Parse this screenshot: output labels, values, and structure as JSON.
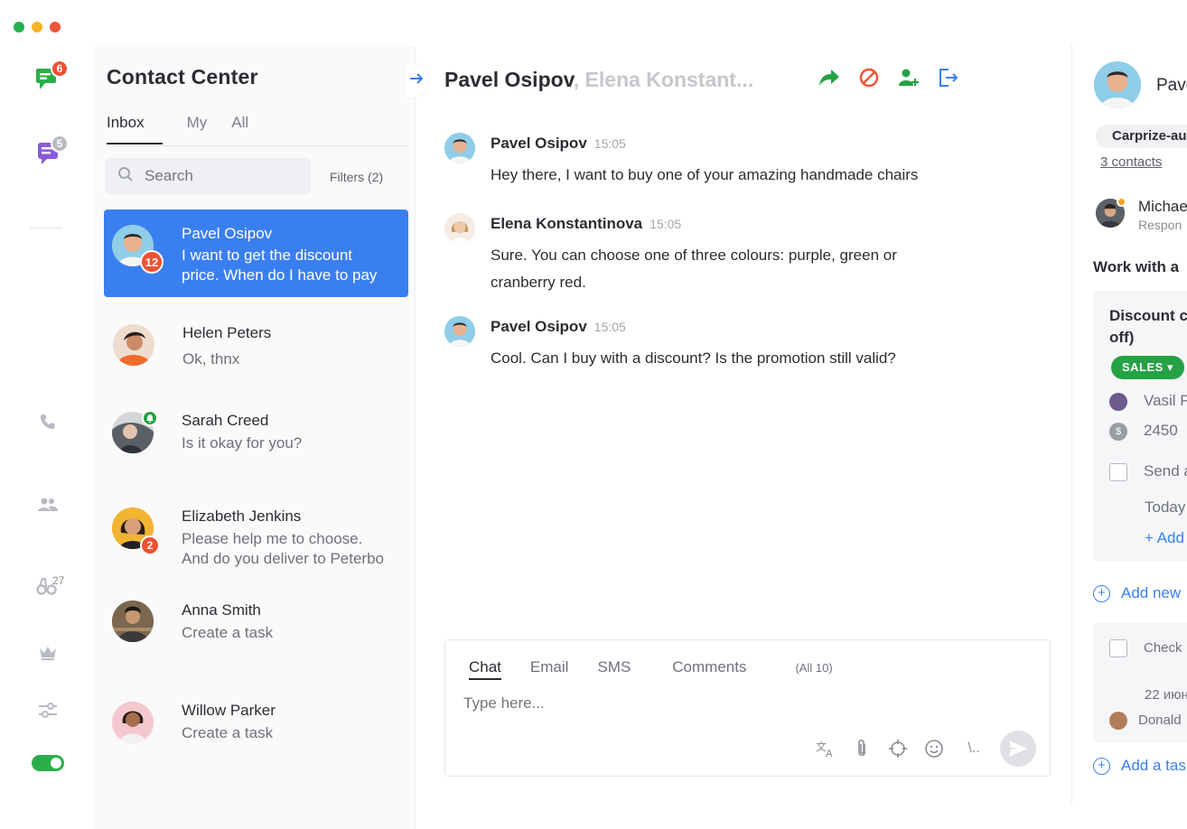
{
  "colors": {
    "accent": "#3a7ff0",
    "badge": "#ee5032",
    "success": "#24a245",
    "purple": "#8a5bd8"
  },
  "rail": {
    "chat_badge": "6",
    "contacts_badge": "5",
    "marketplace_count": "27",
    "icons": [
      "chat-icon",
      "contact-center-icon",
      "phone-icon",
      "users-icon",
      "binoculars-icon",
      "crown-icon",
      "sliders-icon",
      "toggle"
    ]
  },
  "list": {
    "title": "Contact Center",
    "tabs": [
      "Inbox",
      "My",
      "All"
    ],
    "search_placeholder": "Search",
    "filters_label": "Filters (2)",
    "contacts": [
      {
        "name": "Pavel Osipov",
        "message_line1": "I want to get the discount",
        "message_line2": "price. When do I have to pay",
        "badge": "12"
      },
      {
        "name": "Helen Peters",
        "message_line1": "Ok, thnx"
      },
      {
        "name": "Sarah Creed",
        "message_line1": "Is it okay for you?"
      },
      {
        "name": "Elizabeth Jenkins",
        "message_line1": "Please help me to choose.",
        "message_line2": "And do you deliver to Peterbo",
        "badge": "2"
      },
      {
        "name": "Anna Smith",
        "message_line1": "Create a task"
      },
      {
        "name": "Willow Parker",
        "message_line1": "Create a task"
      }
    ]
  },
  "chat": {
    "title_main": "Pavel Osipov",
    "title_rest": ", Elena Konstant...",
    "messages": [
      {
        "author": "Pavel Osipov",
        "time": "15:05",
        "text": "Hey there, I want to buy one of your amazing handmade chairs"
      },
      {
        "author": "Elena Konstantinova",
        "time": "15:05",
        "text": "Sure. You can choose one of three colours: purple, green or cranberry red."
      },
      {
        "author": "Pavel Osipov",
        "time": "15:05",
        "text": "Cool. Can I buy with a discount? Is the promotion still valid?"
      }
    ],
    "composer": {
      "tabs": [
        "Chat",
        "Email",
        "SMS",
        "Comments"
      ],
      "count": "(All 10)",
      "placeholder": "Type here...",
      "slash_cmd": "\\.."
    }
  },
  "right": {
    "name": "Pave",
    "company": "Carprize-au",
    "contacts_link": "3 contacts",
    "responsible_name": "Michae",
    "responsible_role": "Respon",
    "work_title": "Work with a",
    "deal": {
      "title_line1": "Discount c",
      "title_line2": "off)",
      "stage": "SALES",
      "person": "Vasil P",
      "amount": "2450",
      "task": "Send a",
      "date": "Today",
      "add_link": "+ Add"
    },
    "add_new": "Add new",
    "task": {
      "title": "Check",
      "date": "22 июн",
      "person": "Donald"
    },
    "add_task": "Add a tas"
  }
}
